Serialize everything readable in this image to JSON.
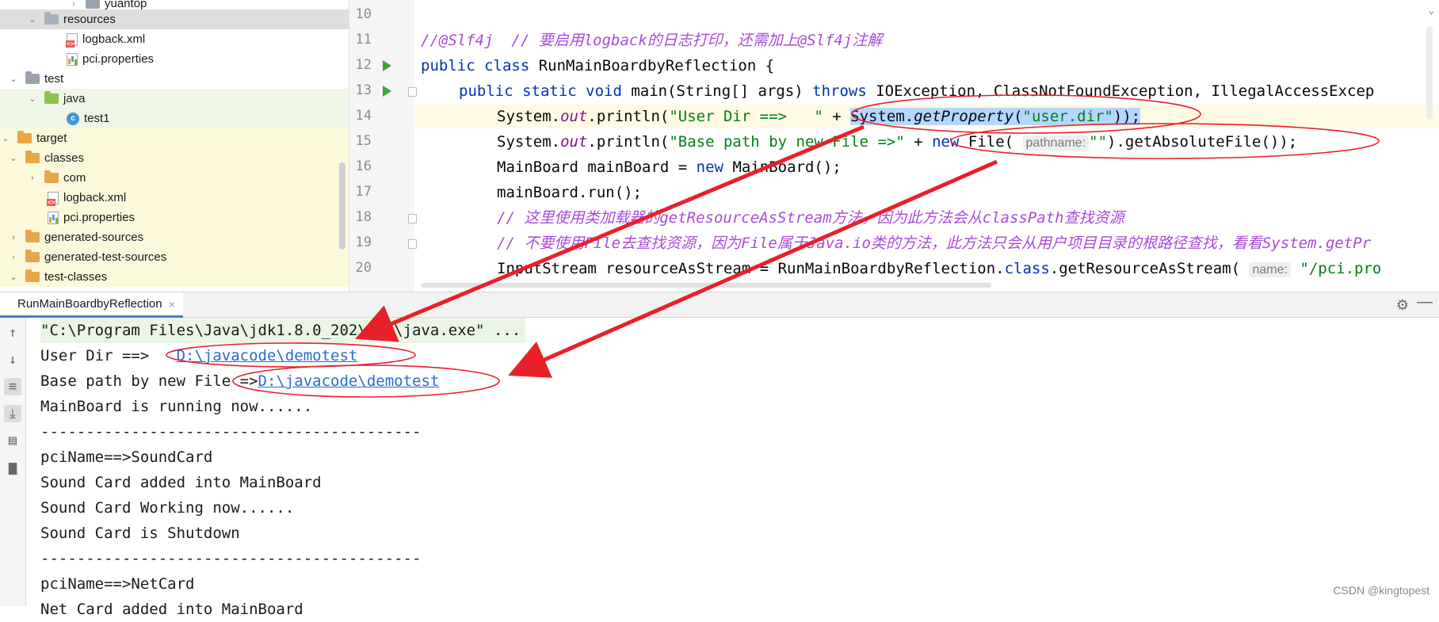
{
  "tree": {
    "items": [
      {
        "label": "yuantop",
        "kind": "folder-grey",
        "indent": 5,
        "chev": "›"
      },
      {
        "label": "resources",
        "kind": "folder-res",
        "indent": 2,
        "chev": "⌄"
      },
      {
        "label": "logback.xml",
        "kind": "xml",
        "indent": 4
      },
      {
        "label": "pci.properties",
        "kind": "prop",
        "indent": 4
      },
      {
        "label": "test",
        "kind": "folder-grey",
        "indent": 0,
        "chev": "⌄"
      },
      {
        "label": "java",
        "kind": "folder-green",
        "indent": 2,
        "chev": "⌄"
      },
      {
        "label": "test1",
        "kind": "class",
        "indent": 4
      },
      {
        "label": "target",
        "kind": "folder-orange",
        "indent": -1,
        "chev": "⌄"
      },
      {
        "label": "classes",
        "kind": "folder-orange",
        "indent": 1,
        "chev": "⌄"
      },
      {
        "label": "com",
        "kind": "folder-orange",
        "indent": 2,
        "chev": "›"
      },
      {
        "label": "logback.xml",
        "kind": "xml",
        "indent": 3
      },
      {
        "label": "pci.properties",
        "kind": "prop",
        "indent": 3
      },
      {
        "label": "generated-sources",
        "kind": "folder-orange",
        "indent": 1,
        "chev": "›"
      },
      {
        "label": "generated-test-sources",
        "kind": "folder-orange",
        "indent": 1,
        "chev": "›"
      },
      {
        "label": "test-classes",
        "kind": "folder-orange",
        "indent": 1,
        "chev": "⌄"
      }
    ]
  },
  "editor": {
    "line_numbers": [
      "10",
      "11",
      "12",
      "13",
      "14",
      "15",
      "16",
      "17",
      "18",
      "19",
      "20"
    ],
    "l11": {
      "c1": "//@Slf4j",
      "c2": "  // 要启用logback的日志打印，还需加上@Slf4j注解"
    },
    "l12": {
      "kw1": "public",
      "kw2": " class",
      "rest": " RunMainBoardbyReflection {"
    },
    "l13": {
      "kw1": "public",
      "kw2": " static",
      "kw3": " void",
      "mid": " main(String[] args) ",
      "kw4": "throws",
      "rest": " IOException, ClassNotFoundException, IllegalAccessExcep"
    },
    "l14": {
      "a": "System.",
      "b": "out",
      "c": ".println(",
      "s1": "\"User Dir ==>   \"",
      "d": " + ",
      "e": "System.",
      "f": "getProperty",
      "g": "(",
      "s2": "\"user.dir\"",
      "h": "));"
    },
    "l15": {
      "a": "System.",
      "b": "out",
      "c": ".println(",
      "s1": "\"Base path by new File =>\"",
      "d": " + ",
      "kw": "new",
      "e": " File( ",
      "hint": "pathname:",
      "s2": "\"\"",
      "f": ").getAbsoluteFile());"
    },
    "l16": {
      "a": "MainBoard mainBoard = ",
      "kw": "new",
      "b": " MainBoard();"
    },
    "l17": {
      "a": "mainBoard.run();"
    },
    "l18": {
      "c": "// 这里使用类加载器的getResourceAsStream方法，因为此方法会从classPath查找资源"
    },
    "l19": {
      "c": "// 不要使用File去查找资源，因为File属于Java.io类的方法，此方法只会从用户项目目录的根路径查找，看看System.getPr"
    },
    "l20": {
      "a": "InputStream resourceAsStream = RunMainBoardbyReflection.",
      "kw": "class",
      "b": ".getResourceAsStream( ",
      "hint": "name:",
      "s": " \"/pci.pro"
    }
  },
  "run_panel": {
    "tab_label": "RunMainBoardbyReflection",
    "close": "×",
    "gear": "⚙",
    "minimize": "—"
  },
  "console": {
    "cmd": "\"C:\\Program Files\\Java\\jdk1.8.0_202\\bin\\java.exe\" ...",
    "user_dir_prefix": "User Dir ==>   ",
    "user_dir_link": "D:\\javacode\\demotest",
    "base_path_prefix": "Base path by new File =>",
    "base_path_link": "D:\\javacode\\demotest",
    "lines": [
      "MainBoard is running now......",
      "------------------------------------------",
      "pciName==>SoundCard",
      "Sound Card added into MainBoard",
      "Sound Card Working now......",
      "Sound Card is Shutdown",
      "------------------------------------------",
      "pciName==>NetCard",
      "Net Card added into MainBoard"
    ]
  },
  "watermark": "CSDN @kingtopest",
  "colors": {
    "annotation": "#e8202a",
    "keyword": "#0033b3",
    "string": "#067d17",
    "comment": "#a84bd8",
    "link": "#2a6bd1"
  }
}
